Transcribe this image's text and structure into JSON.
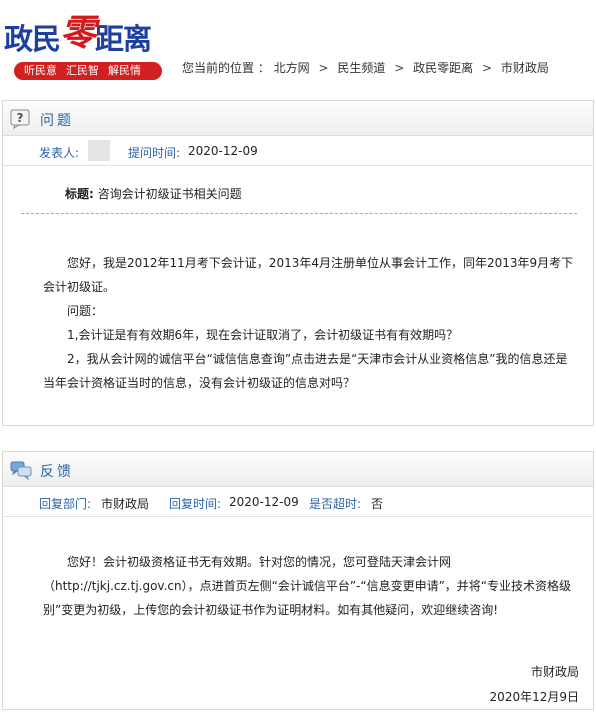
{
  "header": {
    "logo": {
      "part1": "政民",
      "part2": "零",
      "part3": "距离",
      "tags": [
        "听民意",
        "汇民智",
        "解民情"
      ]
    },
    "breadcrumb": {
      "prefix": "您当前的位置 ：",
      "items": [
        "北方网",
        "民生频道",
        "政民零距离",
        "市财政局"
      ]
    }
  },
  "question": {
    "section_title": "问题",
    "poster_label": "发表人:",
    "time_label": "提问时间:",
    "time_value": "2020-12-09",
    "topic_label": "标题:",
    "topic_value": "咨询会计初级证书相关问题",
    "body": {
      "p1": "您好，我是2012年11月考下会计证，2013年4月注册单位从事会计工作，同年2013年9月考下会计初级证。",
      "p2": "问题：",
      "p3": "1,会计证是有有效期6年，现在会计证取消了，会计初级证书有有效期吗？",
      "p4": "2，我从会计网的诚信平台“诚信信息查询”点击进去是“天津市会计从业资格信息”我的信息还是当年会计资格证当时的信息，没有会计初级证的信息对吗？"
    }
  },
  "answer": {
    "section_title": "反馈",
    "dept_label": "回复部门:",
    "dept_value": "市财政局",
    "time_label": "回复时间:",
    "time_value": "2020-12-09",
    "overdue_label": "是否超时:",
    "overdue_value": "否",
    "body": {
      "p1": "您好！会计初级资格证书无有效期。针对您的情况，您可登陆天津会计网（http://tjkj.cz.tj.gov.cn），点进首页左侧“会计诚信平台”-“信息变更申请”，并将“专业技术资格级别”变更为初级，上传您的会计初级证书作为证明材料。如有其他疑问，欢迎继续咨询!"
    },
    "signature": "市财政局",
    "date": "2020年12月9日"
  },
  "colors": {
    "accent_blue": "#2d63a6",
    "logo_blue": "#1d3f9e",
    "logo_red": "#d4191c",
    "tag_bar": "#d21f1f"
  },
  "icons": {
    "question": "question-mark-icon",
    "feedback": "chat-bubbles-icon"
  }
}
